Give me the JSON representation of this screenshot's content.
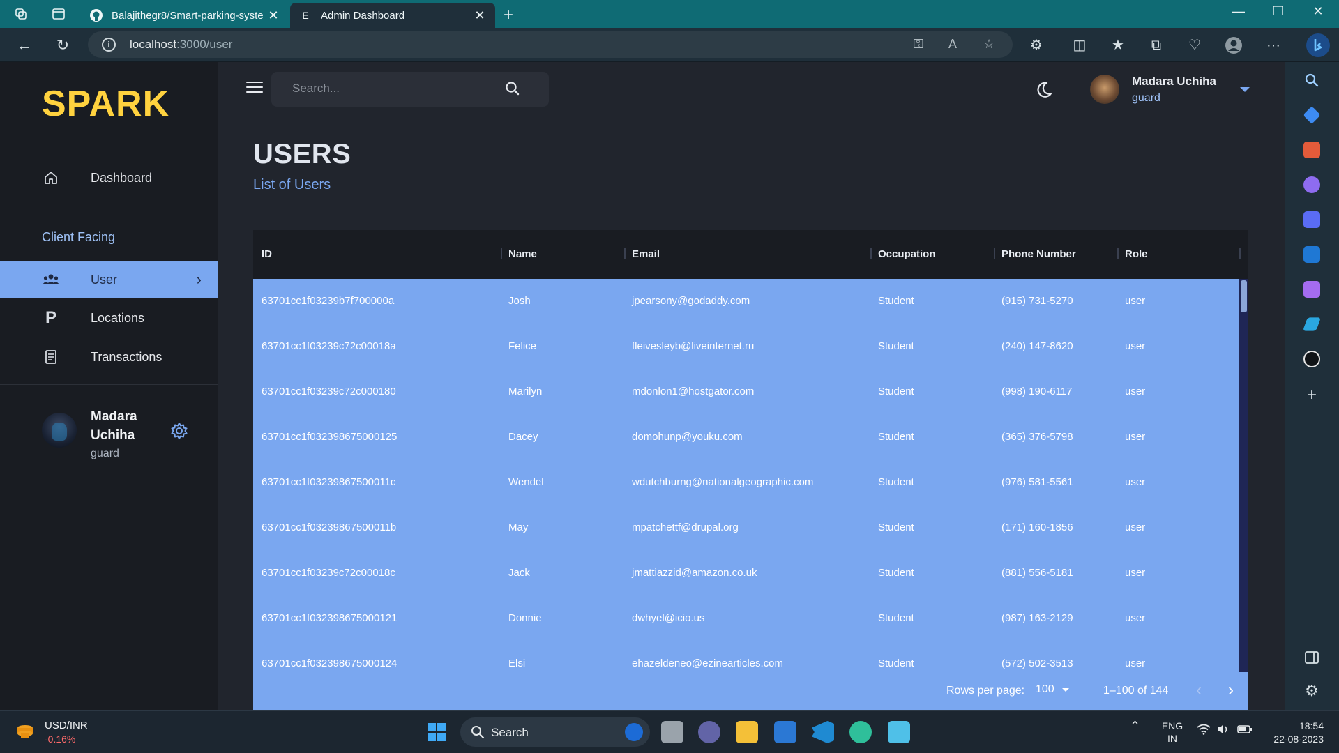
{
  "browser": {
    "tabs": [
      {
        "title": "Balajithegr8/Smart-parking-syste",
        "favicon": "github-icon"
      },
      {
        "title": "Admin Dashboard",
        "favicon": "E"
      }
    ],
    "url_host": "localhost",
    "url_rest": ":3000/user"
  },
  "app": {
    "brand": "SPARK",
    "nav": {
      "dashboard": "Dashboard",
      "section": "Client Facing",
      "user": "User",
      "locations": "Locations",
      "transactions": "Transactions"
    },
    "sidebar_user": {
      "name": "Madara Uchiha",
      "role": "guard"
    },
    "search_placeholder": "Search...",
    "top_user": {
      "name": "Madara Uchiha",
      "role": "guard"
    },
    "page": {
      "title": "USERS",
      "subtitle": "List of Users"
    }
  },
  "grid": {
    "columns": [
      "ID",
      "Name",
      "Email",
      "Occupation",
      "Phone Number",
      "Role"
    ],
    "rows": [
      [
        "63701cc1f03239b7f700000a",
        "Josh",
        "jpearsony@godaddy.com",
        "Student",
        "(915) 731-5270",
        "user"
      ],
      [
        "63701cc1f03239c72c00018a",
        "Felice",
        "fleivesleyb@liveinternet.ru",
        "Student",
        "(240) 147-8620",
        "user"
      ],
      [
        "63701cc1f03239c72c000180",
        "Marilyn",
        "mdonlon1@hostgator.com",
        "Student",
        "(998) 190-6117",
        "user"
      ],
      [
        "63701cc1f032398675000125",
        "Dacey",
        "domohunp@youku.com",
        "Student",
        "(365) 376-5798",
        "user"
      ],
      [
        "63701cc1f03239867500011c",
        "Wendel",
        "wdutchburng@nationalgeographic.com",
        "Student",
        "(976) 581-5561",
        "user"
      ],
      [
        "63701cc1f03239867500011b",
        "May",
        "mpatchettf@drupal.org",
        "Student",
        "(171) 160-1856",
        "user"
      ],
      [
        "63701cc1f03239c72c00018c",
        "Jack",
        "jmattiazzid@amazon.co.uk",
        "Student",
        "(881) 556-5181",
        "user"
      ],
      [
        "63701cc1f032398675000121",
        "Donnie",
        "dwhyel@icio.us",
        "Student",
        "(987) 163-2129",
        "user"
      ],
      [
        "63701cc1f032398675000124",
        "Elsi",
        "ehazeldeneo@ezinearticles.com",
        "Student",
        "(572) 502-3513",
        "user"
      ]
    ],
    "rows_per_page_label": "Rows per page:",
    "rows_per_page": "100",
    "range": "1–100 of 144"
  },
  "taskbar": {
    "fx_pair": "USD/INR",
    "fx_change": "-0.16%",
    "search": "Search",
    "lang1": "ENG",
    "lang2": "IN",
    "time": "18:54",
    "date": "22-08-2023"
  }
}
